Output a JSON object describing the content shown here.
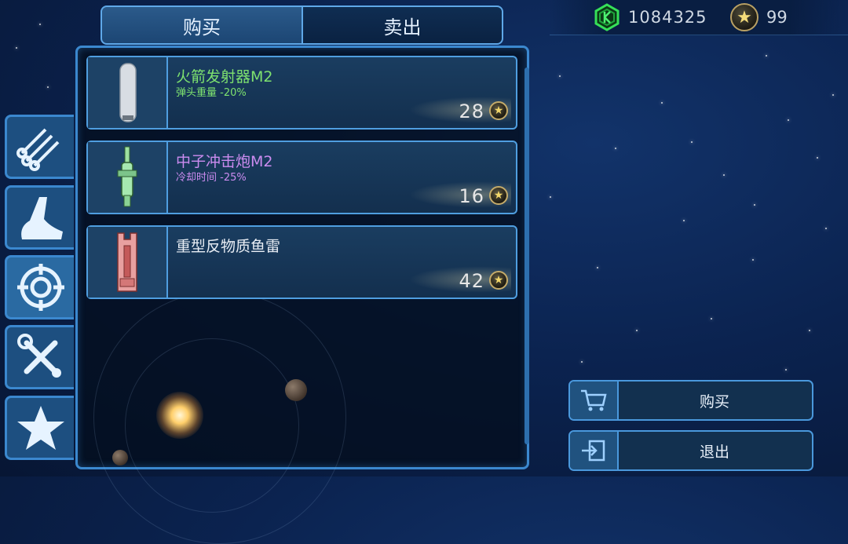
{
  "currency": {
    "gems": "1084325",
    "stars": "99"
  },
  "tabs": {
    "buy": "购买",
    "sell": "卖出"
  },
  "items": [
    {
      "name": "火箭发射器M2",
      "sub": "弹头重量 -20%",
      "price": "28",
      "color": "green",
      "icon": "rocket-launcher-icon"
    },
    {
      "name": "中子冲击炮M2",
      "sub": "冷却时间 -25%",
      "price": "16",
      "color": "purple",
      "icon": "neutron-cannon-icon"
    },
    {
      "name": "重型反物质鱼雷",
      "sub": "",
      "price": "42",
      "color": "white",
      "icon": "antimatter-torpedo-icon"
    }
  ],
  "categories": [
    "ammo-cluster-icon",
    "ship-hull-icon",
    "crosshair-icon",
    "tools-icon",
    "star-icon"
  ],
  "actions": {
    "buy": "购买",
    "exit": "退出"
  },
  "colors": {
    "accent": "#4f9ee0",
    "green_text": "#7ee26f",
    "purple_text": "#cc8cf0"
  }
}
